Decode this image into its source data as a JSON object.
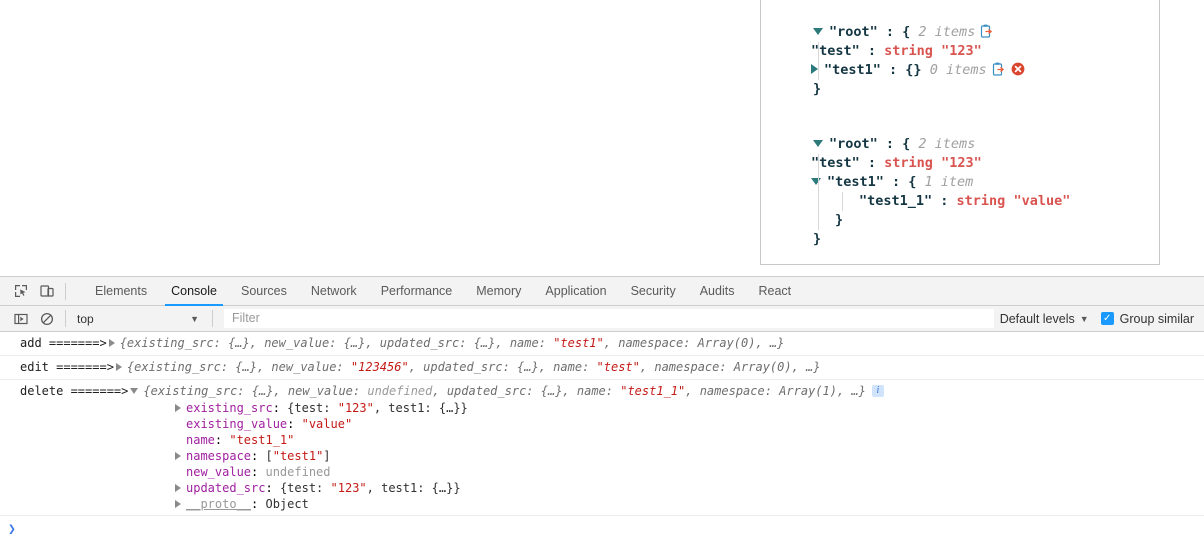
{
  "json_viewer": {
    "blocks": [
      {
        "name": "json-tree-before",
        "root_key": "\"root\"",
        "root_open": "{",
        "root_count": "2 items",
        "root_has_clipboard": true,
        "rows": [
          {
            "type": "leaf",
            "key": "\"test\"",
            "sep": " : ",
            "value_type": "string",
            "value": "\"123\"",
            "clipboard": false,
            "delete": false
          },
          {
            "type": "collapsed-object",
            "triangle": "right",
            "key": "\"test1\"",
            "sep": " : ",
            "braces": "{}",
            "count": "0 items",
            "clipboard": true,
            "delete": true
          }
        ],
        "close_brace": "}"
      },
      {
        "name": "json-tree-after",
        "root_key": "\"root\"",
        "root_open": "{",
        "root_count": "2 items",
        "root_has_clipboard": false,
        "rows": [
          {
            "type": "leaf",
            "key": "\"test\"",
            "sep": " : ",
            "value_type": "string",
            "value": "\"123\"",
            "clipboard": false,
            "delete": false
          },
          {
            "type": "expanded-object",
            "triangle": "down",
            "key": "\"test1\"",
            "sep": " : ",
            "open_brace": "{",
            "count": "1 item",
            "child": {
              "key": "\"test1_1\"",
              "sep": " : ",
              "value_type": "string",
              "value": "\"value\""
            },
            "close_brace": "}"
          }
        ],
        "close_brace": "}"
      }
    ]
  },
  "devtools": {
    "toolbar_icons": [
      {
        "name": "inspect-element-icon",
        "title": "Inspect"
      },
      {
        "name": "device-toolbar-icon",
        "title": "Toggle device toolbar"
      }
    ],
    "tabs": [
      {
        "label": "Elements",
        "active": false
      },
      {
        "label": "Console",
        "active": true
      },
      {
        "label": "Sources",
        "active": false
      },
      {
        "label": "Network",
        "active": false
      },
      {
        "label": "Performance",
        "active": false
      },
      {
        "label": "Memory",
        "active": false
      },
      {
        "label": "Application",
        "active": false
      },
      {
        "label": "Security",
        "active": false
      },
      {
        "label": "Audits",
        "active": false
      },
      {
        "label": "React",
        "active": false
      }
    ],
    "active_tab_underline_color": "#1a9afe",
    "filterbar": {
      "sidebar_toggle_icon": "console-sidebar-icon",
      "clear_console_icon": "clear-console-icon",
      "context_value": "top",
      "context_caret": "▼",
      "filter_placeholder": "Filter",
      "filter_value": "",
      "levels_label": "Default levels",
      "levels_caret": "▼",
      "group_similar_label": "Group similar",
      "group_similar_checked": true,
      "checkbox_color": "#1a9afe",
      "checkbox_glyph": "✓"
    }
  },
  "console": {
    "messages": [
      {
        "name": "console-message-add",
        "label": "add =======>",
        "expanded": false,
        "preview_parts": [
          {
            "t": "plain",
            "s": "{existing_src: {…}, new_value: {…}, updated_src: {…}, name: "
          },
          {
            "t": "str",
            "s": "\"test1\""
          },
          {
            "t": "plain",
            "s": ", namespace: Array(0), …}"
          }
        ],
        "info_icon": false
      },
      {
        "name": "console-message-edit",
        "label": "edit =======>",
        "expanded": false,
        "preview_parts": [
          {
            "t": "plain",
            "s": "{existing_src: {…}, new_value: "
          },
          {
            "t": "str",
            "s": "\"123456\""
          },
          {
            "t": "plain",
            "s": ", updated_src: {…}, name: "
          },
          {
            "t": "str",
            "s": "\"test\""
          },
          {
            "t": "plain",
            "s": ", namespace: Array(0), …}"
          }
        ],
        "info_icon": false
      },
      {
        "name": "console-message-delete",
        "label": "delete =======>",
        "expanded": true,
        "preview_parts": [
          {
            "t": "plain",
            "s": "{existing_src: {…}, new_value: "
          },
          {
            "t": "undef",
            "s": "undefined"
          },
          {
            "t": "plain",
            "s": ", updated_src: {…}, name: "
          },
          {
            "t": "str",
            "s": "\"test1_1\""
          },
          {
            "t": "plain",
            "s": ", namespace: Array(1), …}"
          }
        ],
        "info_icon": true,
        "properties": [
          {
            "expandable": true,
            "name": "existing_src",
            "value_parts": [
              {
                "t": "plain",
                "s": "{test: "
              },
              {
                "t": "str",
                "s": "\"123\""
              },
              {
                "t": "plain",
                "s": ", test1: {…}}"
              }
            ]
          },
          {
            "expandable": false,
            "name": "existing_value",
            "value_parts": [
              {
                "t": "str",
                "s": "\"value\""
              }
            ]
          },
          {
            "expandable": false,
            "name": "name",
            "value_parts": [
              {
                "t": "str",
                "s": "\"test1_1\""
              }
            ]
          },
          {
            "expandable": true,
            "name": "namespace",
            "value_parts": [
              {
                "t": "plain",
                "s": "["
              },
              {
                "t": "str",
                "s": "\"test1\""
              },
              {
                "t": "plain",
                "s": "]"
              }
            ]
          },
          {
            "expandable": false,
            "name": "new_value",
            "value_parts": [
              {
                "t": "undef",
                "s": "undefined"
              }
            ]
          },
          {
            "expandable": true,
            "name": "updated_src",
            "value_parts": [
              {
                "t": "plain",
                "s": "{test: "
              },
              {
                "t": "str",
                "s": "\"123\""
              },
              {
                "t": "plain",
                "s": ", test1: {…}}"
              }
            ]
          },
          {
            "expandable": true,
            "proto": true,
            "name": "__proto__",
            "value_parts": [
              {
                "t": "plain",
                "s": "Object"
              }
            ]
          }
        ]
      }
    ],
    "prompt_caret": "❯"
  }
}
